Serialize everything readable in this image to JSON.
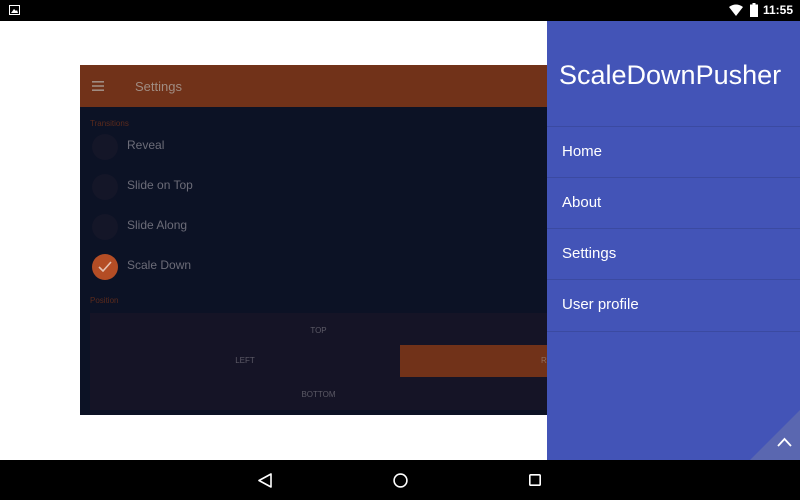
{
  "status_bar": {
    "time": "11:55",
    "icons": [
      "image-notification-icon",
      "wifi-icon",
      "battery-icon"
    ]
  },
  "app": {
    "toolbar_title": "Settings",
    "transitions_label": "Transitions",
    "transitions": [
      {
        "label": "Reveal",
        "checked": false
      },
      {
        "label": "Slide on Top",
        "checked": false
      },
      {
        "label": "Slide Along",
        "checked": false
      },
      {
        "label": "Scale Down",
        "checked": true
      }
    ],
    "position_label": "Position",
    "positions": {
      "top": "TOP",
      "left": "LEFT",
      "right": "R",
      "bottom": "BOTTOM",
      "selected": "RIGHT"
    }
  },
  "drawer": {
    "title": "ScaleDownPusher",
    "items": [
      {
        "label": "Home"
      },
      {
        "label": "About"
      },
      {
        "label": "Settings"
      },
      {
        "label": "User profile"
      }
    ]
  },
  "nav_bar": {
    "icons": [
      "back-icon",
      "home-icon",
      "recents-icon"
    ]
  },
  "colors": {
    "drawer": "#4354b7",
    "toolbar": "#713219",
    "accent": "#b44d25",
    "content_bg": "#0c1225"
  }
}
